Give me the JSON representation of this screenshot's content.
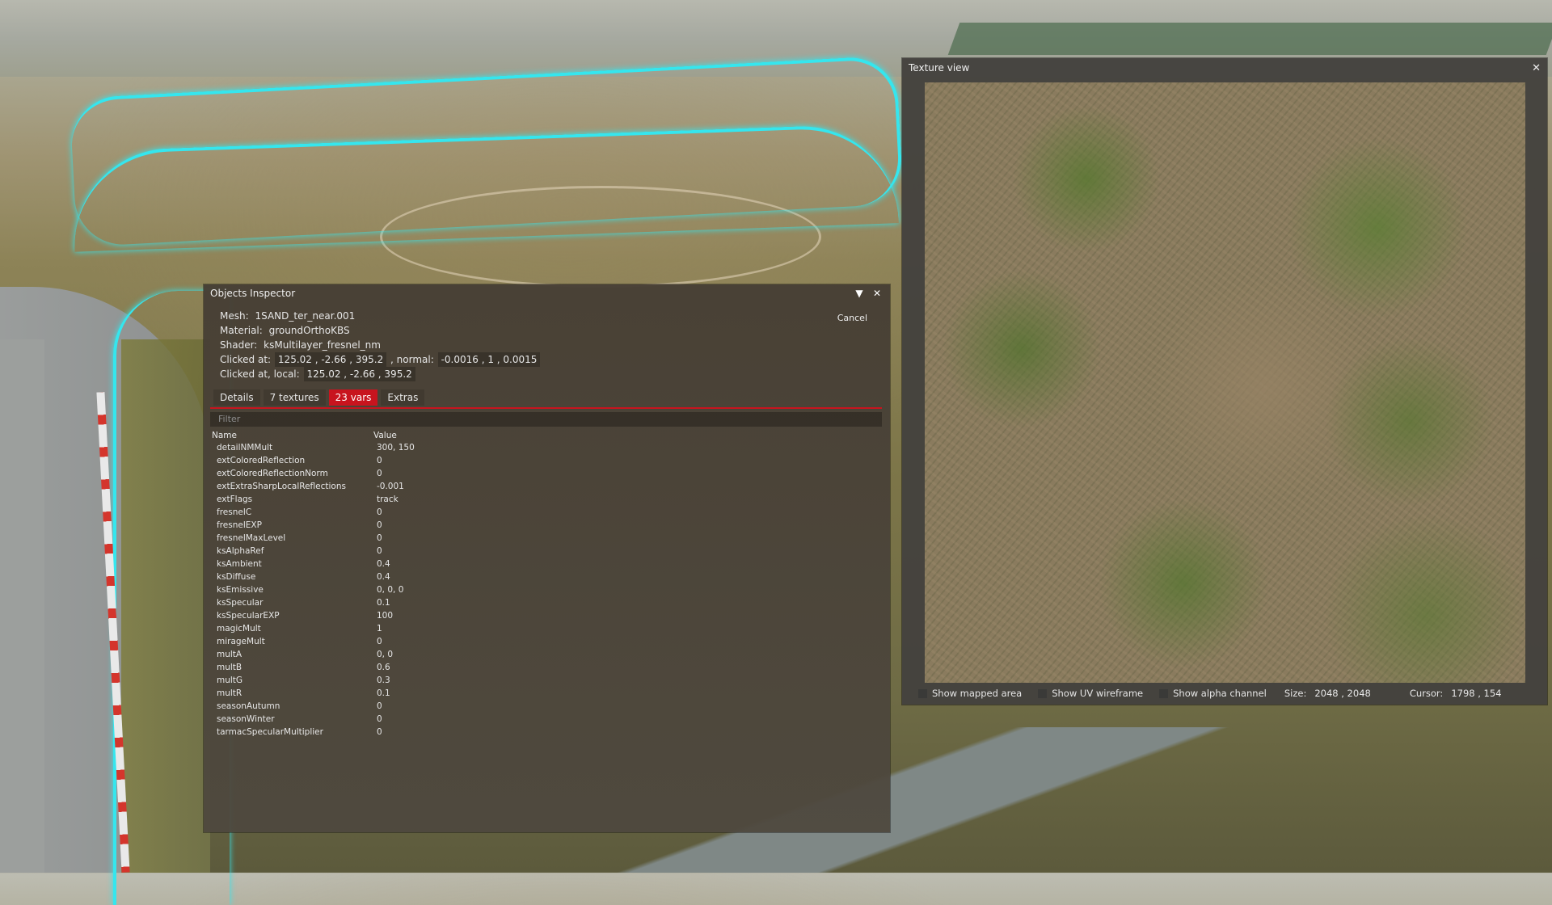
{
  "inspector": {
    "title": "Objects Inspector",
    "collapse_icon": "▼",
    "close_icon": "✕",
    "mesh_label": "Mesh:",
    "mesh": "1SAND_ter_near.001",
    "material_label": "Material:",
    "material": "groundOrthoKBS",
    "shader_label": "Shader:",
    "shader": "ksMultilayer_fresnel_nm",
    "clicked_at_label": "Clicked at:",
    "clicked_at": "125.02 , -2.66 , 395.2",
    "normal_label": ", normal:",
    "normal": "-0.0016 , 1 , 0.0015",
    "clicked_local_label": "Clicked at, local:",
    "clicked_local": "125.02 , -2.66 , 395.2",
    "cancel": "Cancel",
    "tabs": [
      "Details",
      "7 textures",
      "23 vars",
      "Extras"
    ],
    "active_tab": "23 vars",
    "filter_placeholder": "Filter",
    "columns": [
      "Name",
      "Value"
    ],
    "vars": [
      [
        "detailNMMult",
        "300, 150"
      ],
      [
        "extColoredReflection",
        "0"
      ],
      [
        "extColoredReflectionNorm",
        "0"
      ],
      [
        "extExtraSharpLocalReflections",
        "-0.001"
      ],
      [
        "extFlags",
        "track"
      ],
      [
        "fresnelC",
        "0"
      ],
      [
        "fresnelEXP",
        "0"
      ],
      [
        "fresnelMaxLevel",
        "0"
      ],
      [
        "ksAlphaRef",
        "0"
      ],
      [
        "ksAmbient",
        "0.4"
      ],
      [
        "ksDiffuse",
        "0.4"
      ],
      [
        "ksEmissive",
        "0, 0, 0"
      ],
      [
        "ksSpecular",
        "0.1"
      ],
      [
        "ksSpecularEXP",
        "100"
      ],
      [
        "magicMult",
        "1"
      ],
      [
        "mirageMult",
        "0"
      ],
      [
        "multA",
        "0, 0"
      ],
      [
        "multB",
        "0.6"
      ],
      [
        "multG",
        "0.3"
      ],
      [
        "multR",
        "0.1"
      ],
      [
        "seasonAutumn",
        "0"
      ],
      [
        "seasonWinter",
        "0"
      ],
      [
        "tarmacSpecularMultiplier",
        "0"
      ]
    ]
  },
  "texture_view": {
    "title": "Texture view",
    "close_icon": "✕",
    "show_mapped_area": "Show mapped area",
    "show_uv_wireframe": "Show UV wireframe",
    "show_alpha_channel": "Show alpha channel",
    "size_label": "Size:",
    "size": "2048 , 2048",
    "cursor_label": "Cursor:",
    "cursor": "1798 , 154"
  },
  "colors": {
    "accent": "#c8141e",
    "highlight_outline": "#35e6ee"
  }
}
